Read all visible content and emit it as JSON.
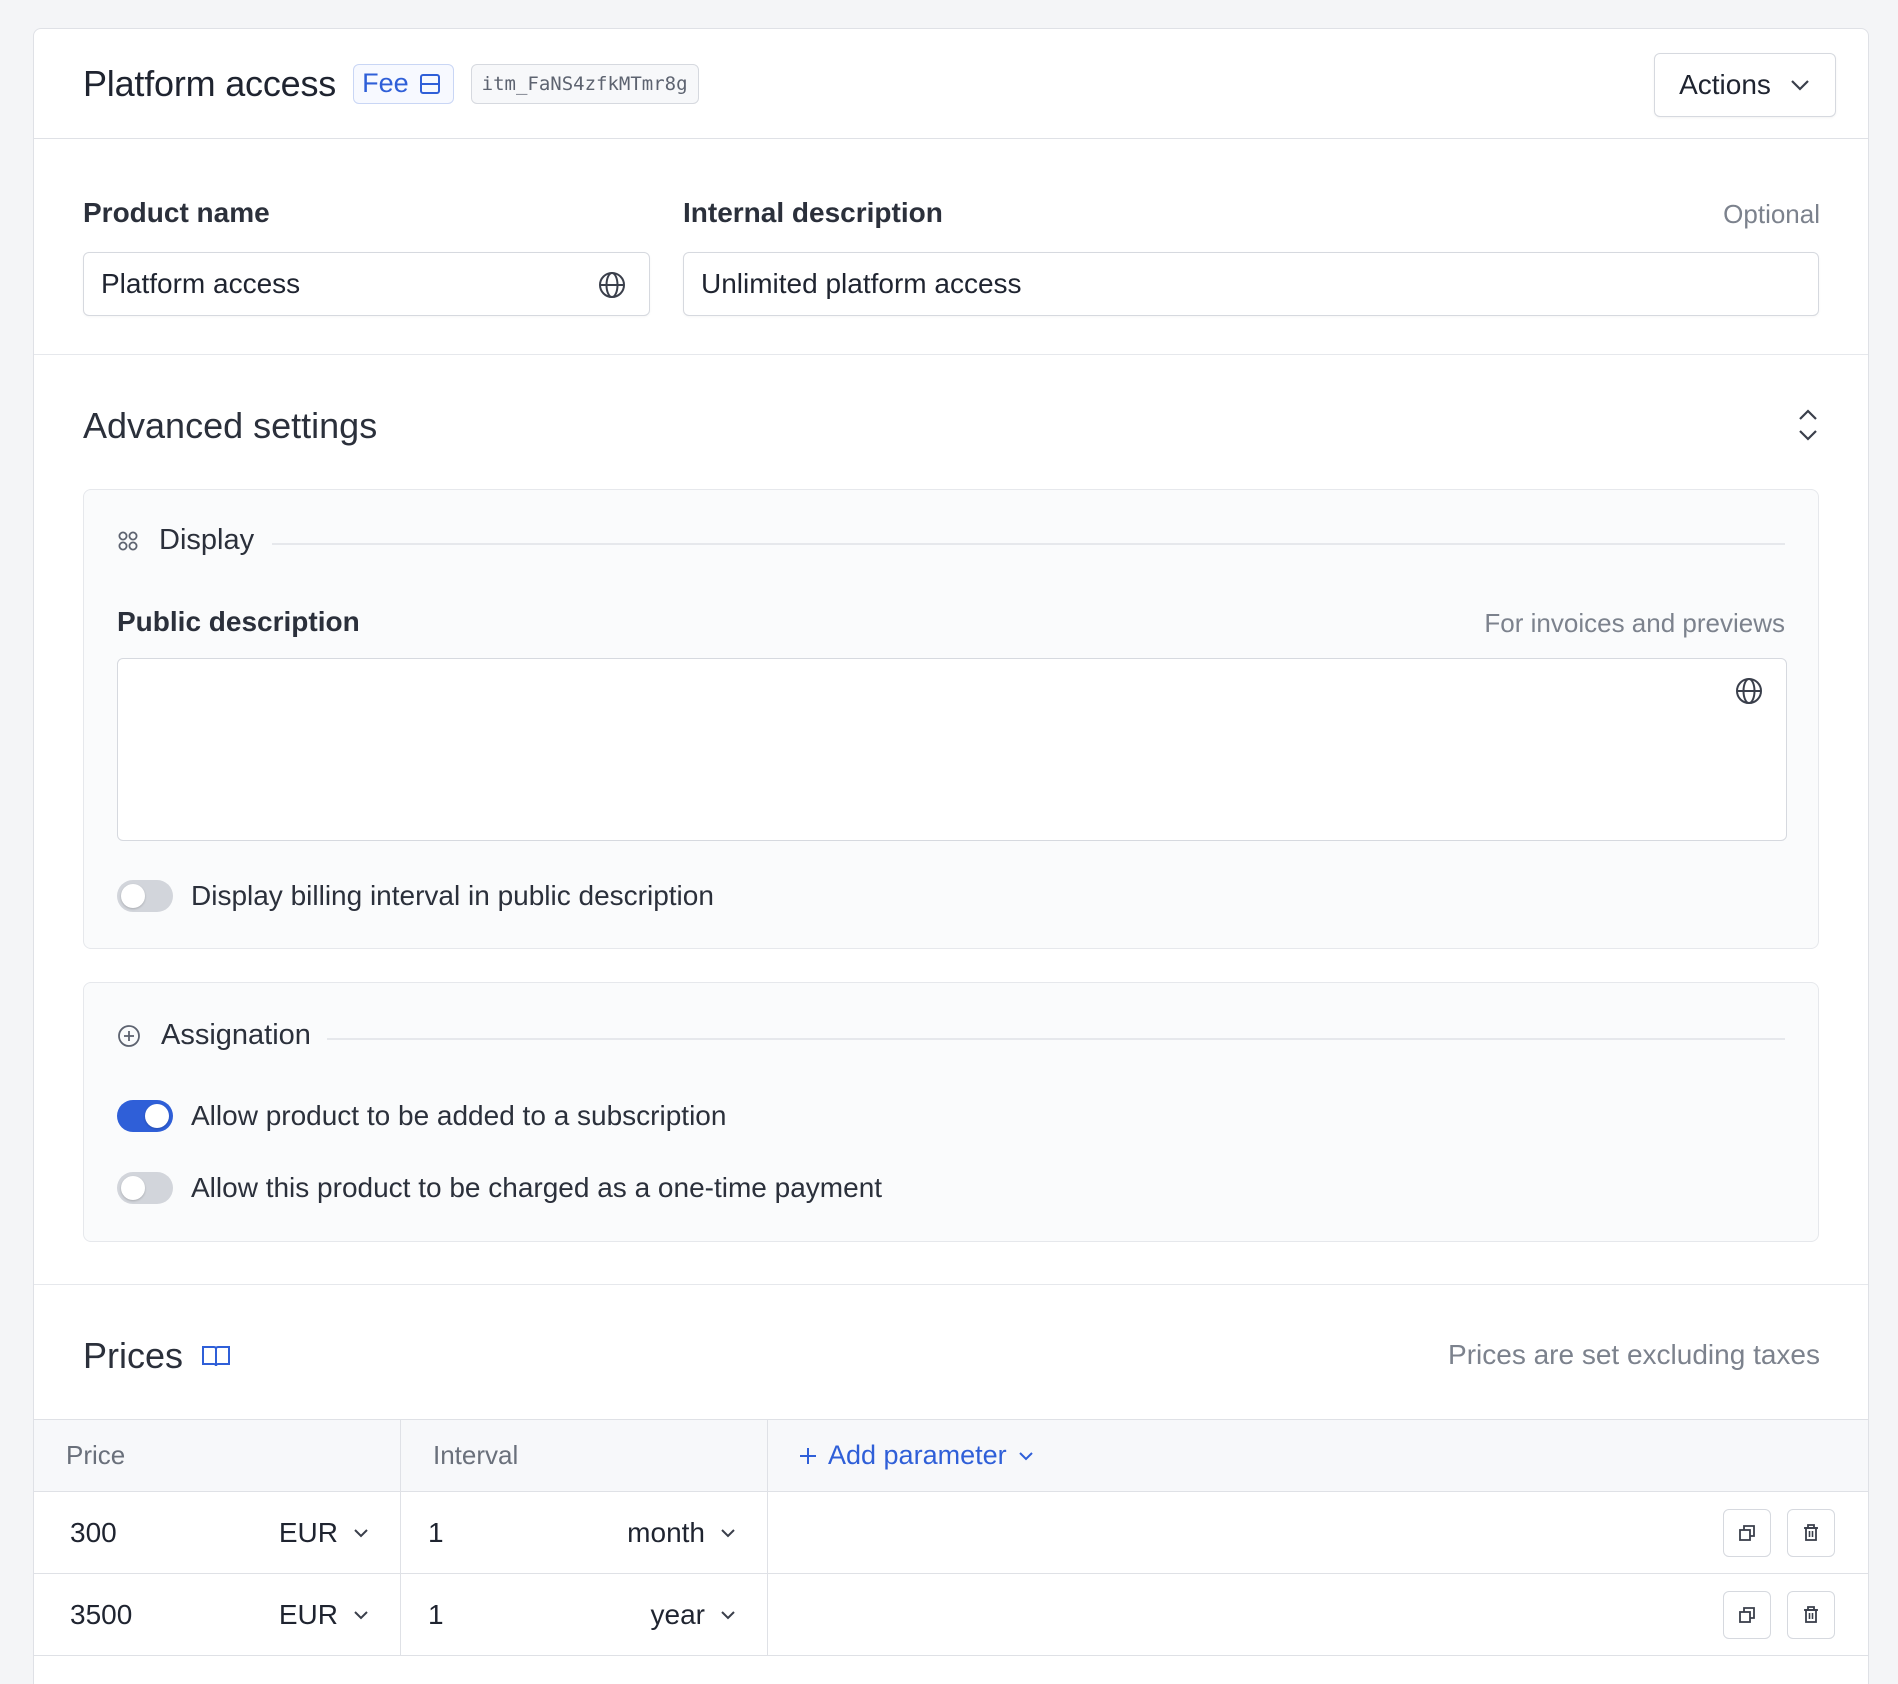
{
  "header": {
    "title": "Platform access",
    "type_badge": "Fee",
    "item_id": "itm_FaNS4zfkMTmr8g",
    "actions_label": "Actions"
  },
  "fields": {
    "product_name_label": "Product name",
    "product_name_value": "Platform access",
    "internal_description_label": "Internal description",
    "internal_description_hint": "Optional",
    "internal_description_value": "Unlimited platform access"
  },
  "advanced": {
    "title": "Advanced settings",
    "display": {
      "title": "Display",
      "public_description_label": "Public description",
      "public_description_hint": "For invoices and previews",
      "public_description_value": "",
      "toggle_billing_interval_label": "Display billing interval in public description",
      "toggle_billing_interval_on": false
    },
    "assignation": {
      "title": "Assignation",
      "toggle_subscription_label": "Allow product to be added to a subscription",
      "toggle_subscription_on": true,
      "toggle_one_time_label": "Allow this product to be charged as a one-time payment",
      "toggle_one_time_on": false
    }
  },
  "prices": {
    "title": "Prices",
    "hint": "Prices are set excluding taxes",
    "columns": [
      "Price",
      "Interval"
    ],
    "add_parameter_label": "Add parameter",
    "rows": [
      {
        "amount": "300",
        "currency": "EUR",
        "interval_count": "1",
        "interval_unit": "month"
      },
      {
        "amount": "3500",
        "currency": "EUR",
        "interval_count": "1",
        "interval_unit": "year"
      }
    ]
  },
  "colors": {
    "accent": "#2f5fd8",
    "border": "#dfe1e6",
    "muted_text": "#7c828d"
  },
  "icons": {
    "badge": "table-icon",
    "actions": "chevron-down-icon",
    "translate": "globe-icon",
    "collapse": "chevron-up-down-icon",
    "display": "grid-dots-icon",
    "assignation": "plus-circle-icon",
    "prices_docs": "book-icon",
    "duplicate": "duplicate-icon",
    "delete": "trash-icon"
  }
}
